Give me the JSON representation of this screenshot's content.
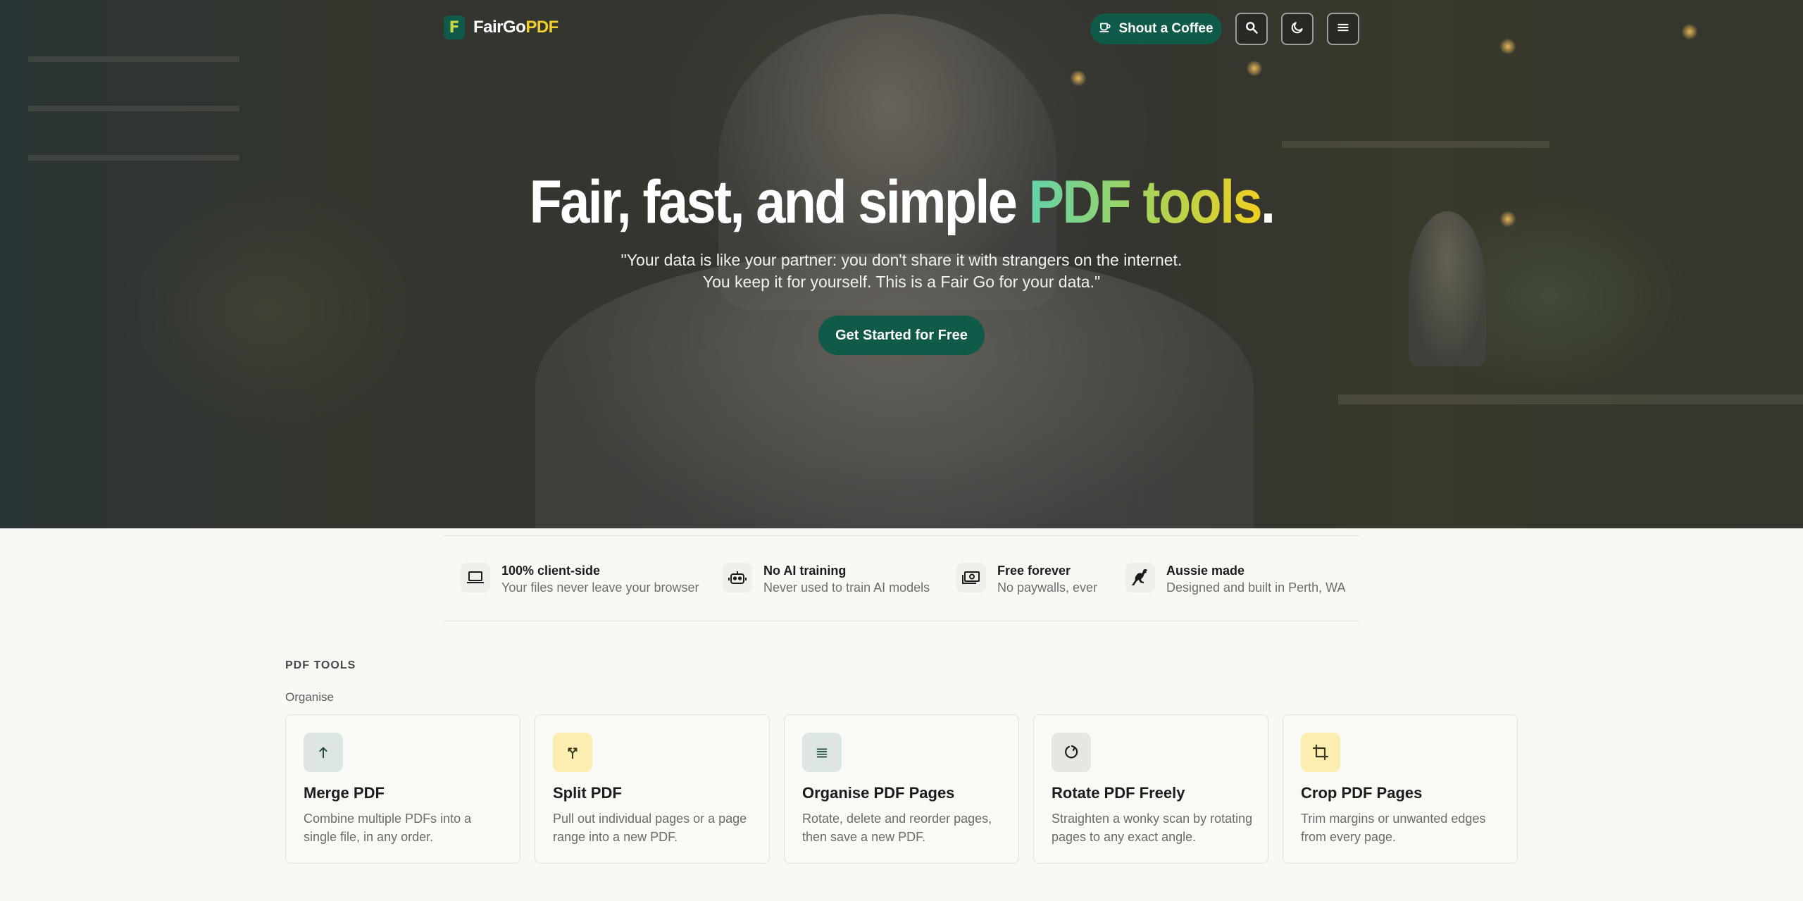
{
  "brand": {
    "name_part1": "FairGo",
    "name_part2": "PDF",
    "logo_letter": "F"
  },
  "header": {
    "coffee_label": "Shout a Coffee",
    "search_icon": "search-icon",
    "theme_icon": "moon-icon",
    "menu_icon": "hamburger-menu-icon"
  },
  "hero": {
    "title_part1": "Fair, fast, and simple ",
    "title_highlight": "PDF tools",
    "title_end": ".",
    "quote": "\"Your data is like your partner: you don't share it with strangers on the internet. You keep it for yourself. This is a Fair Go for your data.\"",
    "cta_label": "Get Started for Free"
  },
  "features": [
    {
      "icon": "laptop-icon",
      "title": "100% client-side",
      "subtitle": "Your files never leave your browser"
    },
    {
      "icon": "robot-icon",
      "title": "No AI training",
      "subtitle": "Never used to train AI models"
    },
    {
      "icon": "money-icon",
      "title": "Free forever",
      "subtitle": "No paywalls, ever"
    },
    {
      "icon": "kangaroo-icon",
      "title": "Aussie made",
      "subtitle": "Designed and built in Perth, WA"
    }
  ],
  "tools": {
    "section_label": "PDF TOOLS",
    "group_label": "Organise",
    "cards": [
      {
        "icon": "merge-icon",
        "icon_bg": "#dde6e1",
        "title": "Merge PDF",
        "description": "Combine multiple PDFs into a single file, in any order."
      },
      {
        "icon": "split-icon",
        "icon_bg": "#fbeeb0",
        "title": "Split PDF",
        "description": "Pull out individual pages or a page range into a new PDF."
      },
      {
        "icon": "list-icon",
        "icon_bg": "#dde6e1",
        "title": "Organise PDF Pages",
        "description": "Rotate, delete and reorder pages, then save a new PDF."
      },
      {
        "icon": "rotate-icon",
        "icon_bg": "#e6e6e2",
        "title": "Rotate PDF Freely",
        "description": "Straighten a wonky scan by rotating pages to any exact angle."
      },
      {
        "icon": "crop-icon",
        "icon_bg": "#fbeeb0",
        "title": "Crop PDF Pages",
        "description": "Trim margins or unwanted edges from every page."
      }
    ]
  },
  "colors": {
    "brand_green": "#0f5a48",
    "brand_yellow": "#f2cf2a",
    "page_bg": "#f8f8f5"
  }
}
